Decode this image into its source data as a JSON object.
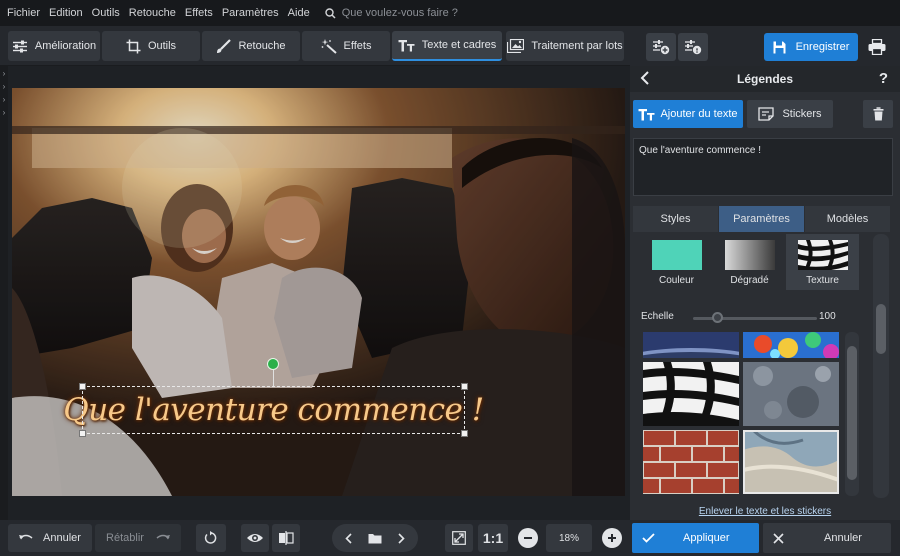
{
  "menu": {
    "items": [
      "Fichier",
      "Edition",
      "Outils",
      "Retouche",
      "Effets",
      "Paramètres",
      "Aide"
    ],
    "search_placeholder": "Que voulez-vous faire ?"
  },
  "tabs": [
    {
      "label": "Amélioration",
      "icon": "sliders-icon"
    },
    {
      "label": "Outils",
      "icon": "crop-icon"
    },
    {
      "label": "Retouche",
      "icon": "brush-icon"
    },
    {
      "label": "Effets",
      "icon": "magic-wand-icon"
    },
    {
      "label": "Texte et cadres",
      "icon": "text-icon",
      "active": true
    },
    {
      "label": "Traitement par lots",
      "icon": "images-icon"
    }
  ],
  "top_actions": {
    "save_label": "Enregistrer",
    "accent_color": "#1f7fd6"
  },
  "canvas": {
    "caption": "Que l'aventure commence !",
    "caption_color": "#f7c98a"
  },
  "bottom_bar": {
    "undo_label": "Annuler",
    "redo_label": "Rétablir",
    "ratio_label": "1:1",
    "zoom_value": "18%"
  },
  "panel": {
    "title": "Légendes",
    "help_label": "?",
    "add_text_label": "Ajouter du texte",
    "stickers_label": "Stickers",
    "text_value": "Que l'aventure commence !",
    "sub_tabs": [
      "Styles",
      "Paramètres",
      "Modèles"
    ],
    "active_sub_tab": "Paramètres",
    "fill_options": [
      {
        "label": "Couleur",
        "swatch": "#4fd3b8"
      },
      {
        "label": "Dégradé",
        "swatch": "gradient"
      },
      {
        "label": "Texture",
        "swatch": "zebra",
        "active": true
      }
    ],
    "scale_label": "Echelle",
    "scale_value": "100",
    "scale_level": 0.2,
    "textures": [
      "planet",
      "psychedelic",
      "zebra",
      "stone",
      "brick",
      "marble"
    ],
    "selected_texture": "marble",
    "remove_label": "Enlever le texte et les stickers",
    "apply_label": "Appliquer",
    "cancel_label": "Annuler"
  }
}
